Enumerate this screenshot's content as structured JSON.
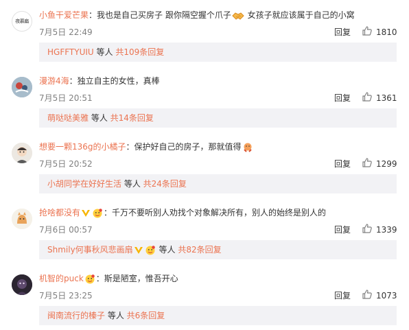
{
  "comments": [
    {
      "user": "小鱼干爱芒果",
      "sep": "：",
      "text_a": "我也是自己买房子  跟你隔空握个爪子",
      "text_b": "  女孩子就应该属于自己的小窝",
      "time": "7月5日 22:49",
      "reply_label": "回复",
      "likes": "1810",
      "sub": {
        "users": "HGFFTYUIU",
        "mid": " 等人 ",
        "count": "共109条回复"
      }
    },
    {
      "user": "漫游4海",
      "sep": "：",
      "text_a": "独立自主的女性，真棒",
      "time": "7月5日 20:51",
      "reply_label": "回复",
      "likes": "1361",
      "sub": {
        "users": "萌哒哒美雅",
        "mid": " 等人 ",
        "count": "共14条回复"
      }
    },
    {
      "user": "想要一颗136g的小橘子",
      "sep": "：",
      "text_a": "保护好自己的房子，那就值得",
      "time": "7月5日 20:52",
      "reply_label": "回复",
      "likes": "1299",
      "sub": {
        "users": "小胡同学在好好生活",
        "mid": " 等人 ",
        "count": "共24条回复"
      }
    },
    {
      "user": "抢啥都没有",
      "sep": "：",
      "text_a": "千万不要听别人劝找个对象解决所有，别人的始终是别人的",
      "time": "7月6日 00:57",
      "reply_label": "回复",
      "likes": "1339",
      "sub": {
        "users": "Shmily何事秋风悲画扇",
        "mid": " 等人 ",
        "count": "共82条回复"
      }
    },
    {
      "user": "机智的puck",
      "sep": "：",
      "text_a": "斯是陋室，惟吾开心",
      "time": "7月5日 23:25",
      "reply_label": "回复",
      "likes": "1073",
      "sub": {
        "users": "闽南流行的榛子",
        "mid": " 等人 ",
        "count": "共6条回复"
      }
    }
  ],
  "colors": {
    "username": "#eb7350",
    "muted": "#808080",
    "subbg": "#f2f2f5"
  },
  "avatar_texts": {
    "first": "夜慕扁"
  }
}
